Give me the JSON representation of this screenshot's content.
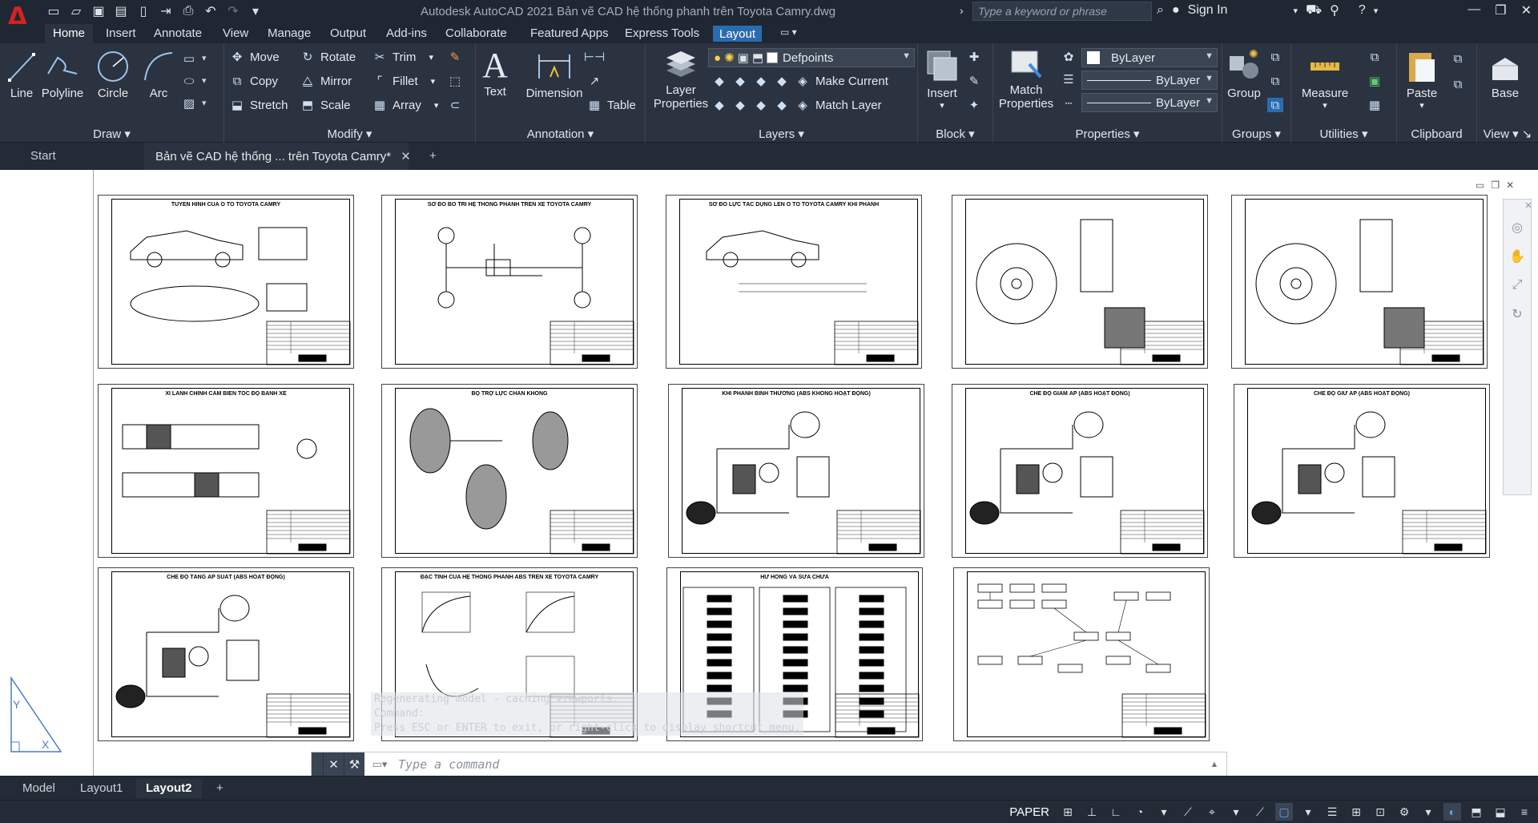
{
  "app": {
    "title": "Autodesk AutoCAD 2021    Bản vẽ CAD hệ thống phanh trên Toyota Camry.dwg",
    "logo_letter": "A",
    "search_placeholder": "Type a keyword or phrase",
    "sign_in": "Sign In"
  },
  "ribbon_tabs": [
    "Home",
    "Insert",
    "Annotate",
    "View",
    "Manage",
    "Output",
    "Add-ins",
    "Collaborate",
    "Featured Apps",
    "Express Tools",
    "Layout"
  ],
  "draw_panel": {
    "title": "Draw",
    "line": "Line",
    "polyline": "Polyline",
    "circle": "Circle",
    "arc": "Arc"
  },
  "modify_panel": {
    "title": "Modify",
    "move": "Move",
    "rotate": "Rotate",
    "trim": "Trim",
    "copy": "Copy",
    "mirror": "Mirror",
    "fillet": "Fillet",
    "stretch": "Stretch",
    "scale": "Scale",
    "array": "Array"
  },
  "annotation_panel": {
    "title": "Annotation",
    "text": "Text",
    "dimension": "Dimension",
    "table": "Table"
  },
  "layers_panel": {
    "title": "Layers",
    "layer_properties_1": "Layer",
    "layer_properties_2": "Properties",
    "current_layer": "Defpoints",
    "make_current": "Make Current",
    "match_layer": "Match Layer"
  },
  "block_panel": {
    "title": "Block",
    "insert": "Insert"
  },
  "properties_panel": {
    "title": "Properties",
    "match_properties_1": "Match",
    "match_properties_2": "Properties",
    "color": "ByLayer",
    "linetype": "ByLayer",
    "lineweight": "ByLayer"
  },
  "groups_panel": {
    "title": "Groups",
    "group": "Group"
  },
  "utilities_panel": {
    "title": "Utilities",
    "measure": "Measure"
  },
  "clipboard_panel": {
    "title": "Clipboard",
    "paste": "Paste"
  },
  "view_panel": {
    "title": "View",
    "base": "Base"
  },
  "doc_tabs": {
    "start": "Start",
    "active": "Bản vẽ CAD hệ thống ... trên Toyota Camry*"
  },
  "sheets": [
    {
      "title": "TUYỂN HÌNH CỦA Ô TÔ TOYOTA CAMRY"
    },
    {
      "title": "SƠ ĐỒ BỐ TRÍ HỆ THỐNG PHANH TRÊN XE TOYOTA CAMRY"
    },
    {
      "title": "SƠ ĐỒ LỰC TÁC DỤNG LÊN Ô TÔ TOYOTA CAMRY KHI PHANH"
    },
    {
      "title": ""
    },
    {
      "title": ""
    },
    {
      "title": "XI LANH CHÍNH              CẢM BIẾN TỐC ĐỘ BÁNH XE"
    },
    {
      "title": "BỘ TRỢ LỰC CHÂN KHÔNG"
    },
    {
      "title": "KHI PHANH BÌNH THƯỜNG (ABS KHÔNG HOẠT ĐỘNG)"
    },
    {
      "title": "CHẾ ĐỘ GIẢM ÁP (ABS HOẠT ĐỘNG)"
    },
    {
      "title": "CHẾ ĐỘ GIỮ ÁP (ABS HOẠT ĐỘNG)"
    },
    {
      "title": "CHẾ ĐỘ TĂNG ÁP SUẤT (ABS HOẠT ĐỘNG)"
    },
    {
      "title": "ĐẶC TÍNH CỦA HỆ THỐNG PHANH ABS TRÊN XE TOYOTA CAMRY"
    },
    {
      "title": "HƯ HỎNG VÀ SỬA CHỮA"
    },
    {
      "title": ""
    }
  ],
  "command": {
    "history": [
      "Regenerating model - caching viewports.",
      "Command:",
      "Press ESC or ENTER to exit, or right-click to display shortcut menu."
    ],
    "placeholder": "Type a command"
  },
  "layout_tabs": [
    "Model",
    "Layout1",
    "Layout2"
  ],
  "status": {
    "space": "PAPER"
  }
}
